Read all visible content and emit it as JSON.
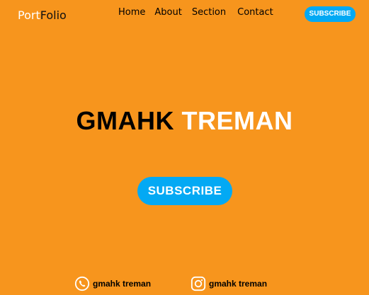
{
  "header": {
    "logo_part1": "Port",
    "logo_part2": "Folio",
    "nav": [
      "Home",
      "About",
      "Section",
      "Contact"
    ],
    "subscribe_label": "SUBSCRIBE"
  },
  "hero": {
    "name_first": "GMAHK",
    "name_last": "TREMAN",
    "subscribe_label": "SUBSCRIBE"
  },
  "footer": {
    "phone_label": "gmahk treman",
    "instagram_label": "gmahk treman"
  },
  "colors": {
    "background": "#f7951d",
    "accent": "#03a9f4",
    "text_dark": "#000000",
    "text_light": "#ffffff"
  },
  "icons": [
    "phone-icon",
    "instagram-icon"
  ]
}
